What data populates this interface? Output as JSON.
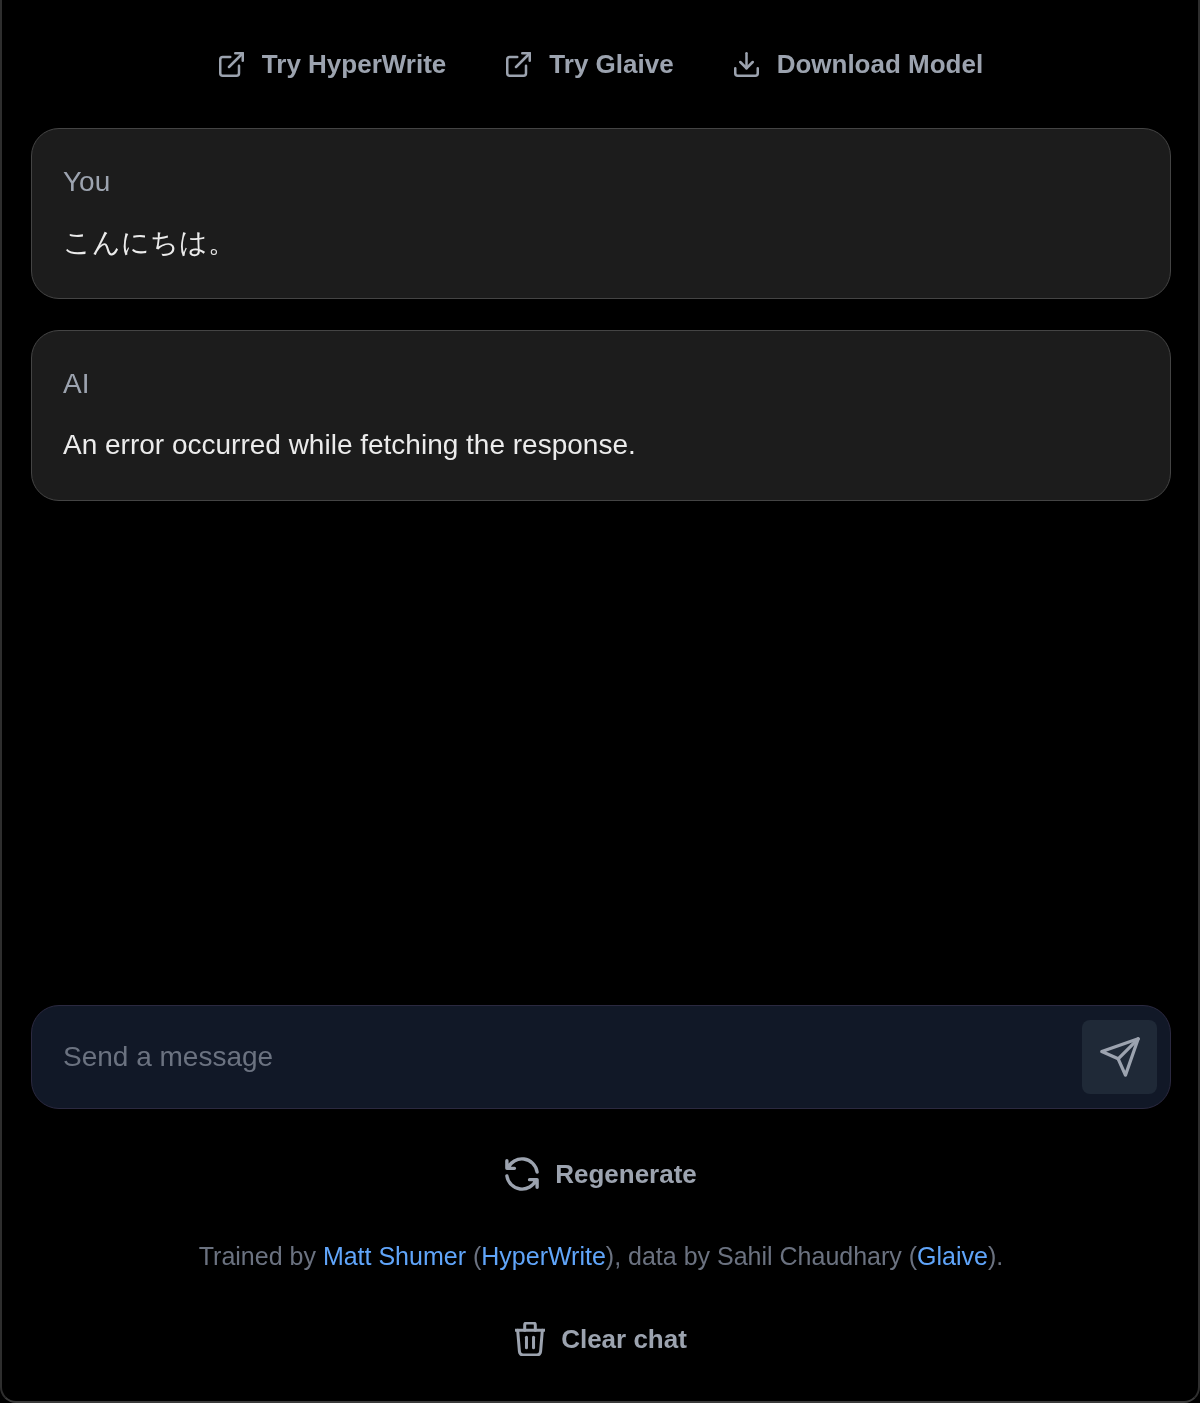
{
  "top_links": [
    {
      "kind": "external",
      "label": "Try HyperWrite"
    },
    {
      "kind": "external",
      "label": "Try Glaive"
    },
    {
      "kind": "download",
      "label": "Download Model"
    }
  ],
  "messages": [
    {
      "sender": "You",
      "text": "こんにちは。"
    },
    {
      "sender": "AI",
      "text": "An error occurred while fetching the response."
    }
  ],
  "composer": {
    "placeholder": "Send a message"
  },
  "regenerate_button": {
    "label": "Regenerate"
  },
  "credits": [
    {
      "kind": "text",
      "text": "Trained by "
    },
    {
      "kind": "link",
      "text": "Matt Shumer"
    },
    {
      "kind": "text",
      "text": " ("
    },
    {
      "kind": "link",
      "text": "HyperWrite"
    },
    {
      "kind": "text",
      "text": "), data by Sahil Chaudhary ("
    },
    {
      "kind": "link",
      "text": "Glaive"
    },
    {
      "kind": "text",
      "text": ")."
    }
  ],
  "clear_button": {
    "label": "Clear chat"
  }
}
